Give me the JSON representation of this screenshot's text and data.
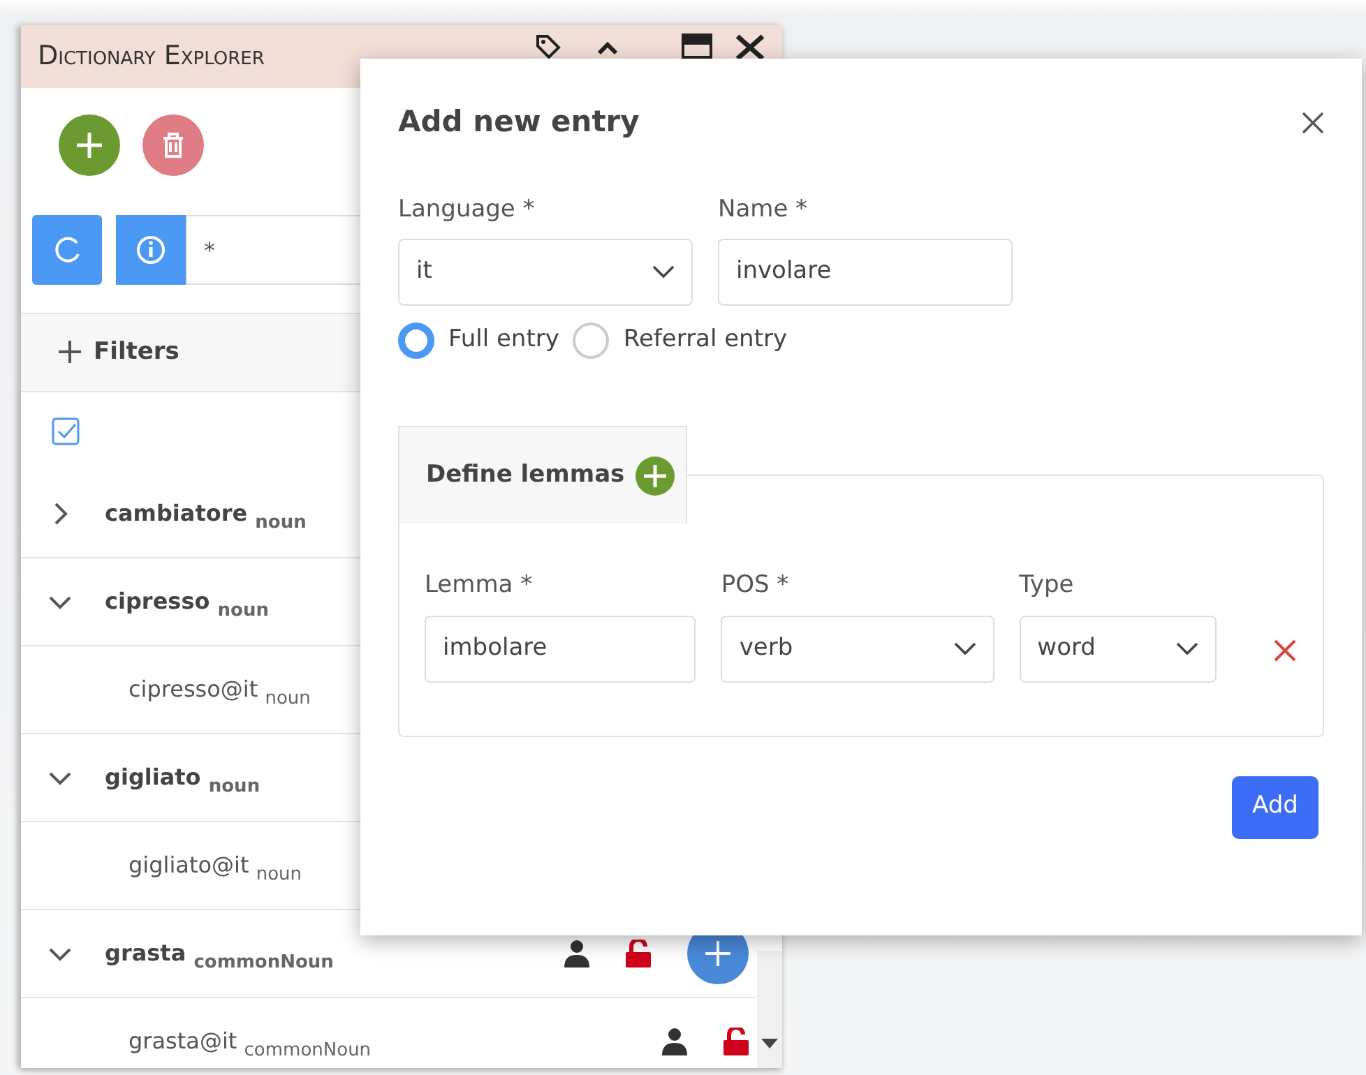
{
  "explorer": {
    "title": "Dictionary Explorer",
    "search": {
      "value": "*"
    },
    "filters_label": "Filters",
    "entries": [
      {
        "lemma": "cambiatore",
        "pos": "noun",
        "expanded": false
      },
      {
        "lemma": "cipresso",
        "pos": "noun",
        "expanded": true,
        "children": [
          {
            "lemma": "cipresso@it",
            "pos": "noun"
          }
        ]
      },
      {
        "lemma": "gigliato",
        "pos": "noun",
        "expanded": true,
        "children": [
          {
            "lemma": "gigliato@it",
            "pos": "noun"
          }
        ]
      },
      {
        "lemma": "grasta",
        "pos": "commonNoun",
        "expanded": true,
        "locked": false,
        "children": [
          {
            "lemma": "grasta@it",
            "pos": "commonNoun",
            "locked": false
          }
        ]
      }
    ]
  },
  "dialog": {
    "title": "Add new entry",
    "language": {
      "label": "Language *",
      "value": "it"
    },
    "name": {
      "label": "Name *",
      "value": "involare"
    },
    "entry_types": [
      {
        "label": "Full entry",
        "selected": true
      },
      {
        "label": "Referral entry",
        "selected": false
      }
    ],
    "lemmas_tab": "Define lemmas",
    "lemmas": [
      {
        "lemma": {
          "label": "Lemma *",
          "value": "imbolare"
        },
        "pos": {
          "label": "POS *",
          "value": "verb"
        },
        "type": {
          "label": "Type",
          "value": "word"
        }
      }
    ],
    "submit": "Add"
  }
}
